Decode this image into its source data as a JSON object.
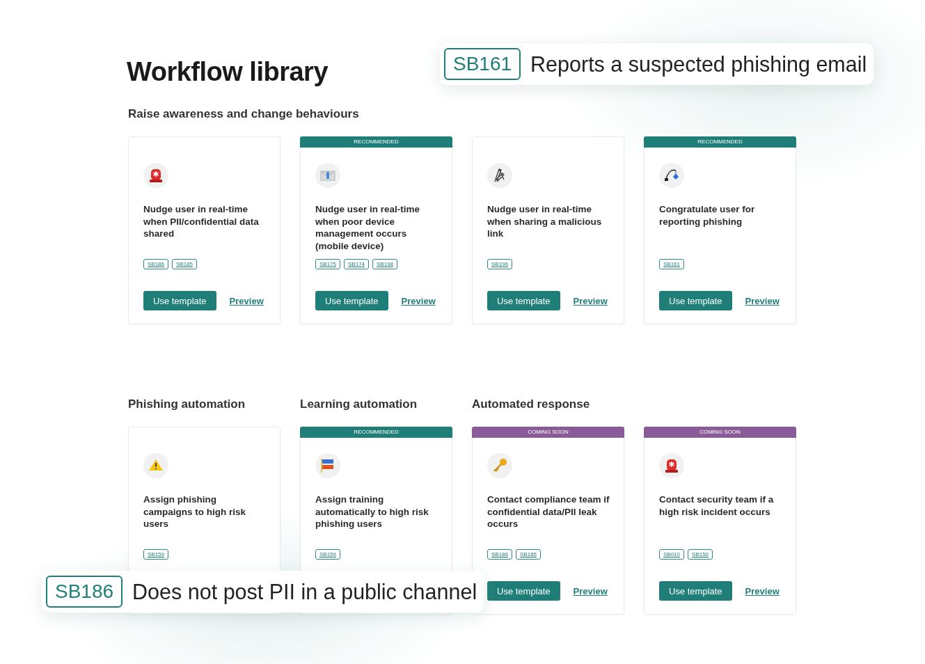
{
  "title": "Workflow library",
  "rows": [
    {
      "groups": [
        {
          "heading": "Raise awareness and change behaviours",
          "cards": [
            {
              "kind": "siren",
              "title": "Nudge user in real-time when PII/confidential data shared",
              "tags": [
                "SB186",
                "SB185"
              ],
              "button": "Use template",
              "link": "Preview"
            },
            {
              "banner": {
                "kind": "recommended",
                "text": "RECOMMENDED"
              },
              "kind": "envelope",
              "title": "Nudge user in real-time when poor device management occurs (mobile device)",
              "tags": [
                "SB175",
                "SB174",
                "SB198"
              ],
              "button": "Use template",
              "link": "Preview"
            },
            {
              "kind": "paperclip",
              "title": "Nudge user in real-time when sharing a malicious link",
              "tags": [
                "SB196"
              ],
              "button": "Use template",
              "link": "Preview"
            },
            {
              "banner": {
                "kind": "recommended",
                "text": "RECOMMENDED"
              },
              "kind": "fishing",
              "title": "Congratulate user for reporting phishing",
              "tags": [
                "SB161"
              ],
              "button": "Use template",
              "link": "Preview"
            }
          ]
        }
      ]
    },
    {
      "groups": [
        {
          "heading": "Phishing automation",
          "cards": [
            {
              "kind": "warning",
              "title": "Assign phishing campaigns to high risk users",
              "tags": [
                "SB159"
              ]
            }
          ]
        },
        {
          "heading": "Learning automation",
          "cards": [
            {
              "banner": {
                "kind": "recommended",
                "text": "RECOMMENDED"
              },
              "kind": "flags",
              "title": "Assign training automatically to high risk phishing users",
              "tags": [
                "SB159"
              ]
            }
          ]
        },
        {
          "heading": "Automated response",
          "cards": [
            {
              "banner": {
                "kind": "coming_soon",
                "text": "COMING SOON"
              },
              "kind": "key",
              "title": "Contact compliance team if confidential data/PII leak occurs",
              "tags": [
                "SB186",
                "SB185"
              ],
              "button": "Use template",
              "link": "Preview"
            },
            {
              "banner": {
                "kind": "coming_soon",
                "text": "COMING SOON"
              },
              "kind": "siren",
              "title": "Contact security team if a high risk incident occurs",
              "tags": [
                "SB010",
                "SB150"
              ],
              "button": "Use template",
              "link": "Preview"
            }
          ]
        }
      ]
    }
  ],
  "callouts": [
    {
      "code": "SB161",
      "text": "Reports a suspected phishing email"
    },
    {
      "code": "SB186",
      "text": "Does not post PII in a public channel"
    }
  ]
}
